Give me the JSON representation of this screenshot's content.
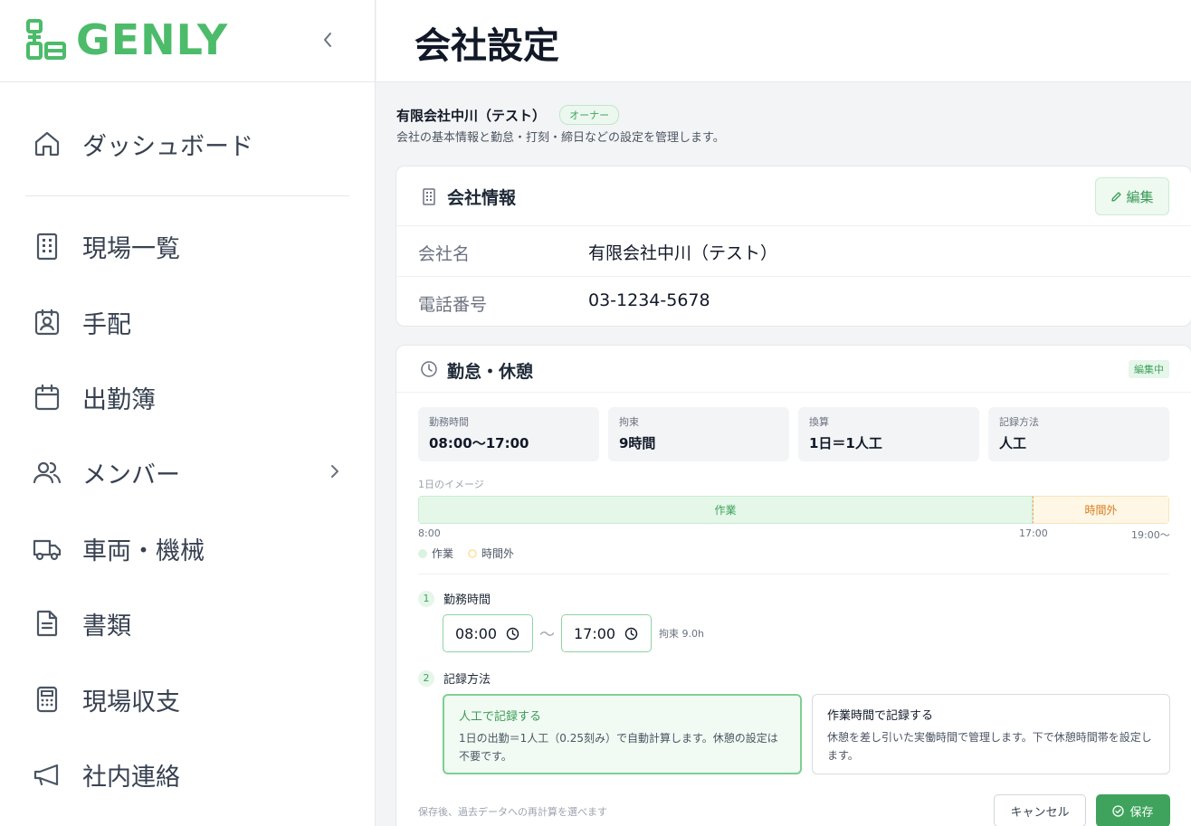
{
  "brand": {
    "name": "GENLY",
    "color": "#4cbb6a"
  },
  "sidebar": {
    "items": [
      {
        "label": "ダッシュボード",
        "icon": "home-icon"
      },
      {
        "label": "現場一覧",
        "icon": "building-icon"
      },
      {
        "label": "手配",
        "icon": "badge-icon"
      },
      {
        "label": "出勤簿",
        "icon": "calendar-icon"
      },
      {
        "label": "メンバー",
        "icon": "users-icon"
      },
      {
        "label": "車両・機械",
        "icon": "truck-icon"
      },
      {
        "label": "書類",
        "icon": "document-icon"
      },
      {
        "label": "現場収支",
        "icon": "calculator-icon"
      },
      {
        "label": "社内連絡",
        "icon": "megaphone-icon"
      }
    ]
  },
  "header": {
    "title": "会社設定"
  },
  "company": {
    "name": "有限会社中川（テスト）",
    "role_badge": "オーナー",
    "description": "会社の基本情報と勤怠・打刻・締日などの設定を管理します。"
  },
  "company_info": {
    "title": "会社情報",
    "edit_label": "編集",
    "rows": [
      {
        "label": "会社名",
        "value": "有限会社中川（テスト）"
      },
      {
        "label": "電話番号",
        "value": "03-1234-5678"
      }
    ]
  },
  "attendance": {
    "title": "勤怠・休憩",
    "status_badge": "編集中",
    "stats": [
      {
        "label": "勤務時間",
        "value": "08:00〜17:00"
      },
      {
        "label": "拘束",
        "value": "9時間"
      },
      {
        "label": "換算",
        "value": "1日＝1人工"
      },
      {
        "label": "記録方法",
        "value": "人工"
      }
    ],
    "timeline": {
      "label": "1日のイメージ",
      "work_label": "作業",
      "overtime_label": "時間外",
      "work_fraction": 0.818,
      "ticks": [
        "8:00",
        "17:00",
        "19:00〜"
      ],
      "legend": [
        {
          "label": "作業",
          "color": "#d9f3df"
        },
        {
          "label": "時間外",
          "color": "#fde7b0"
        }
      ]
    },
    "step1": {
      "num": "1",
      "label": "勤務時間",
      "start": "08:00",
      "end": "17:00",
      "separator": "〜",
      "kousoku": "拘束 9.0h"
    },
    "step2": {
      "num": "2",
      "label": "記録方法",
      "options": [
        {
          "title": "人工で記録する",
          "desc": "1日の出勤＝1人工（0.25刻み）で自動計算します。休憩の設定は不要です。",
          "selected": true
        },
        {
          "title": "作業時間で記録する",
          "desc": "休憩を差し引いた実働時間で管理します。下で休憩時間帯を設定します。",
          "selected": false
        }
      ]
    },
    "footer_note": "保存後、過去データへの再計算を選べます",
    "cancel_label": "キャンセル",
    "save_label": "保存"
  }
}
